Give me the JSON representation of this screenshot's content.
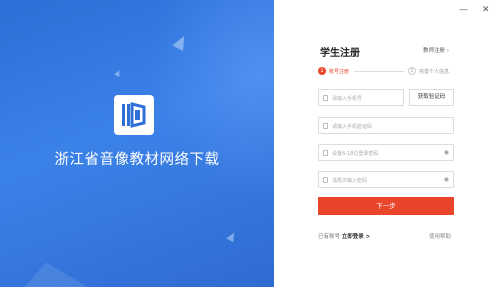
{
  "left_panel": {
    "app_title": "浙江省音像教材网络下载",
    "logo_icon": "book-logo-icon",
    "bg_color": "#3378e0"
  },
  "window_controls": {
    "minimize": "—",
    "close": "✕"
  },
  "form": {
    "title": "学生注册",
    "teacher_link": "教师注册 ›",
    "steps": [
      {
        "number": "1",
        "label": "账号注册"
      },
      {
        "number": "2",
        "label": "完善个人信息"
      }
    ],
    "phone_placeholder": "请输入手机号",
    "get_code_label": "获取验证码",
    "code_placeholder": "请输入手机验证码",
    "password_placeholder": "设置6-18位登录密码",
    "confirm_placeholder": "请再次输入密码",
    "next_label": "下一步",
    "has_account_text": "已有账号",
    "login_link": "立即登录 >",
    "help_link": "使用帮助",
    "accent_color": "#e8452b"
  }
}
